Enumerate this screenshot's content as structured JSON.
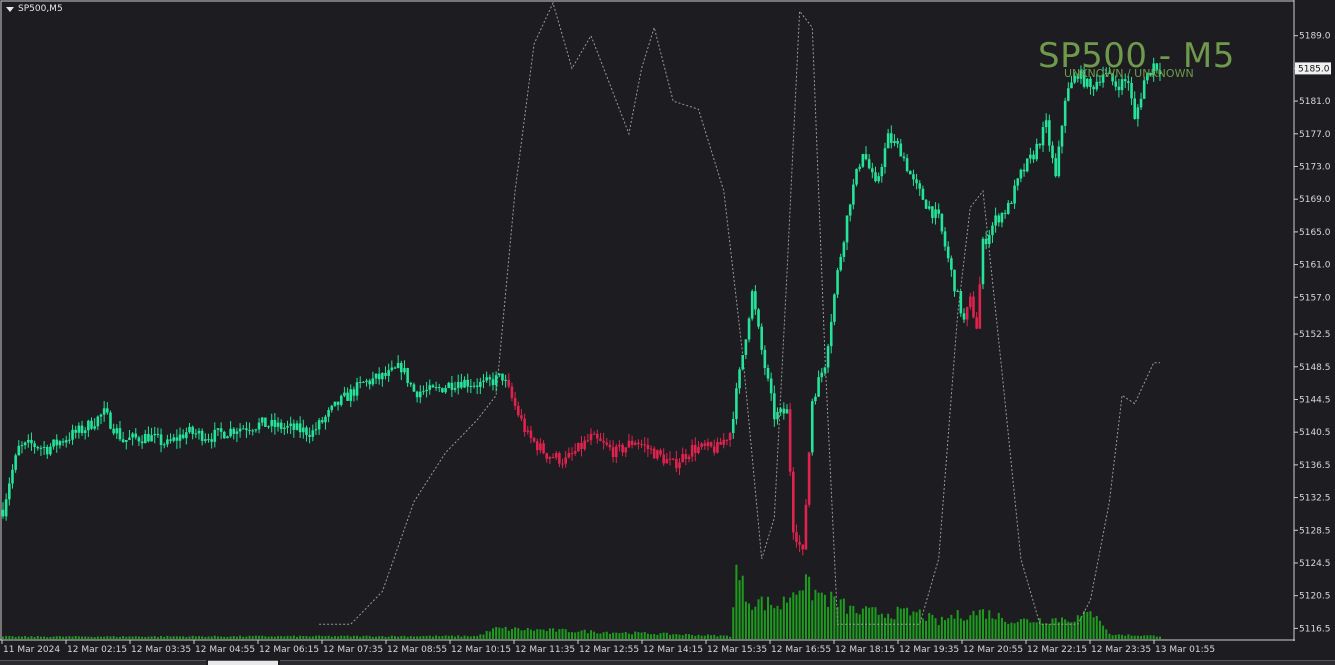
{
  "symbol_label": "SP500,M5",
  "watermark": {
    "title": "SP500 - M5",
    "subtitle": "UNKNOWN / UNKNOWN"
  },
  "colors": {
    "background": "#1c1c21",
    "bull": "#26e39a",
    "bear": "#e0234e",
    "volume": "#1e9c1e",
    "grid_text": "#d8d8d8",
    "indicator": "#9a9a9a",
    "current_price_bg": "#f0f0f0"
  },
  "current_price_label": "5185.0",
  "chart_data": {
    "type": "candlestick",
    "title": "",
    "xlabel": "",
    "ylabel": "",
    "ylim": [
      5115.2,
      5193.0
    ],
    "grid": false,
    "y_ticks": [
      "5189.0",
      "5185.0",
      "5181.0",
      "5177.0",
      "5173.0",
      "5169.0",
      "5165.0",
      "5161.0",
      "5157.0",
      "5152.5",
      "5148.5",
      "5144.5",
      "5140.5",
      "5136.5",
      "5132.5",
      "5128.5",
      "5124.5",
      "5120.5",
      "5116.5"
    ],
    "x_ticks": [
      "11 Mar 2024",
      "12 Mar 02:15",
      "12 Mar 03:35",
      "12 Mar 04:55",
      "12 Mar 06:15",
      "12 Mar 07:35",
      "12 Mar 08:55",
      "12 Mar 10:15",
      "12 Mar 11:35",
      "12 Mar 12:55",
      "12 Mar 14:15",
      "12 Mar 15:35",
      "12 Mar 16:55",
      "12 Mar 18:15",
      "12 Mar 19:35",
      "12 Mar 20:55",
      "12 Mar 22:15",
      "12 Mar 23:35",
      "13 Mar 01:55"
    ],
    "price_path": [
      {
        "bar": 0,
        "price": 5131.0
      },
      {
        "bar": 2,
        "price": 5134.5
      },
      {
        "bar": 5,
        "price": 5138.5
      },
      {
        "bar": 9,
        "price": 5139.0
      },
      {
        "bar": 14,
        "price": 5138.5
      },
      {
        "bar": 20,
        "price": 5139.8
      },
      {
        "bar": 26,
        "price": 5141.0
      },
      {
        "bar": 32,
        "price": 5142.8
      },
      {
        "bar": 38,
        "price": 5139.5
      },
      {
        "bar": 46,
        "price": 5140.0
      },
      {
        "bar": 52,
        "price": 5139.0
      },
      {
        "bar": 58,
        "price": 5140.5
      },
      {
        "bar": 66,
        "price": 5140.0
      },
      {
        "bar": 74,
        "price": 5141.0
      },
      {
        "bar": 82,
        "price": 5141.5
      },
      {
        "bar": 90,
        "price": 5141.0
      },
      {
        "bar": 98,
        "price": 5140.5
      },
      {
        "bar": 106,
        "price": 5144.0
      },
      {
        "bar": 114,
        "price": 5146.5
      },
      {
        "bar": 122,
        "price": 5147.5
      },
      {
        "bar": 126,
        "price": 5148.5
      },
      {
        "bar": 130,
        "price": 5145.5
      },
      {
        "bar": 136,
        "price": 5145.5
      },
      {
        "bar": 144,
        "price": 5146.8
      },
      {
        "bar": 152,
        "price": 5146.3
      },
      {
        "bar": 158,
        "price": 5147.3
      },
      {
        "bar": 160,
        "price": 5145.5
      },
      {
        "bar": 166,
        "price": 5140.0
      },
      {
        "bar": 172,
        "price": 5137.8
      },
      {
        "bar": 178,
        "price": 5137.0
      },
      {
        "bar": 186,
        "price": 5139.8
      },
      {
        "bar": 194,
        "price": 5138.0
      },
      {
        "bar": 200,
        "price": 5139.5
      },
      {
        "bar": 206,
        "price": 5138.0
      },
      {
        "bar": 212,
        "price": 5136.5
      },
      {
        "bar": 218,
        "price": 5138.5
      },
      {
        "bar": 226,
        "price": 5138.5
      },
      {
        "bar": 230,
        "price": 5140.5
      },
      {
        "bar": 234,
        "price": 5150.0
      },
      {
        "bar": 237,
        "price": 5157.5
      },
      {
        "bar": 240,
        "price": 5150.5
      },
      {
        "bar": 244,
        "price": 5142.5
      },
      {
        "bar": 248,
        "price": 5143.0
      },
      {
        "bar": 250,
        "price": 5129.0
      },
      {
        "bar": 253,
        "price": 5125.5
      },
      {
        "bar": 256,
        "price": 5144.5
      },
      {
        "bar": 260,
        "price": 5149.0
      },
      {
        "bar": 264,
        "price": 5160.0
      },
      {
        "bar": 268,
        "price": 5169.0
      },
      {
        "bar": 272,
        "price": 5175.0
      },
      {
        "bar": 276,
        "price": 5170.5
      },
      {
        "bar": 280,
        "price": 5176.5
      },
      {
        "bar": 284,
        "price": 5175.0
      },
      {
        "bar": 288,
        "price": 5171.0
      },
      {
        "bar": 292,
        "price": 5168.5
      },
      {
        "bar": 296,
        "price": 5166.5
      },
      {
        "bar": 300,
        "price": 5160.0
      },
      {
        "bar": 304,
        "price": 5154.0
      },
      {
        "bar": 306,
        "price": 5156.5
      },
      {
        "bar": 308,
        "price": 5153.5
      },
      {
        "bar": 310,
        "price": 5163.5
      },
      {
        "bar": 314,
        "price": 5166.5
      },
      {
        "bar": 318,
        "price": 5168.0
      },
      {
        "bar": 322,
        "price": 5172.0
      },
      {
        "bar": 326,
        "price": 5174.5
      },
      {
        "bar": 330,
        "price": 5178.0
      },
      {
        "bar": 333,
        "price": 5171.5
      },
      {
        "bar": 336,
        "price": 5181.5
      },
      {
        "bar": 340,
        "price": 5184.5
      },
      {
        "bar": 344,
        "price": 5182.5
      },
      {
        "bar": 348,
        "price": 5184.5
      },
      {
        "bar": 352,
        "price": 5183.0
      },
      {
        "bar": 356,
        "price": 5183.5
      },
      {
        "bar": 358,
        "price": 5178.5
      },
      {
        "bar": 361,
        "price": 5183.5
      },
      {
        "bar": 364,
        "price": 5185.5
      },
      {
        "bar": 366,
        "price": 5185.0
      }
    ],
    "volume_path": [
      {
        "bar": 0,
        "v": 0.08
      },
      {
        "bar": 150,
        "v": 0.1
      },
      {
        "bar": 156,
        "v": 0.35
      },
      {
        "bar": 230,
        "v": 0.1
      },
      {
        "bar": 232,
        "v": 2.2
      },
      {
        "bar": 236,
        "v": 1.3
      },
      {
        "bar": 246,
        "v": 1.1
      },
      {
        "bar": 252,
        "v": 1.9
      },
      {
        "bar": 256,
        "v": 1.6
      },
      {
        "bar": 270,
        "v": 0.9
      },
      {
        "bar": 290,
        "v": 0.85
      },
      {
        "bar": 296,
        "v": 0.55
      },
      {
        "bar": 300,
        "v": 0.75
      },
      {
        "bar": 310,
        "v": 0.9
      },
      {
        "bar": 320,
        "v": 0.6
      },
      {
        "bar": 340,
        "v": 0.7
      },
      {
        "bar": 346,
        "v": 0.9
      },
      {
        "bar": 350,
        "v": 0.15
      },
      {
        "bar": 366,
        "v": 0.1
      }
    ],
    "indicator_path": [
      {
        "bar": 100,
        "price": 5117.0
      },
      {
        "bar": 110,
        "price": 5117.0
      },
      {
        "bar": 120,
        "price": 5121.0
      },
      {
        "bar": 130,
        "price": 5132.0
      },
      {
        "bar": 140,
        "price": 5138.0
      },
      {
        "bar": 150,
        "price": 5142.0
      },
      {
        "bar": 156,
        "price": 5145.0
      },
      {
        "bar": 162,
        "price": 5170.0
      },
      {
        "bar": 168,
        "price": 5188.0
      },
      {
        "bar": 174,
        "price": 5193.0
      },
      {
        "bar": 180,
        "price": 5185.0
      },
      {
        "bar": 186,
        "price": 5189.0
      },
      {
        "bar": 192,
        "price": 5183.0
      },
      {
        "bar": 198,
        "price": 5177.0
      },
      {
        "bar": 202,
        "price": 5185.0
      },
      {
        "bar": 206,
        "price": 5190.0
      },
      {
        "bar": 212,
        "price": 5181.0
      },
      {
        "bar": 220,
        "price": 5180.0
      },
      {
        "bar": 228,
        "price": 5170.0
      },
      {
        "bar": 234,
        "price": 5150.0
      },
      {
        "bar": 240,
        "price": 5125.0
      },
      {
        "bar": 244,
        "price": 5130.0
      },
      {
        "bar": 248,
        "price": 5160.0
      },
      {
        "bar": 252,
        "price": 5192.0
      },
      {
        "bar": 256,
        "price": 5190.0
      },
      {
        "bar": 260,
        "price": 5150.0
      },
      {
        "bar": 264,
        "price": 5117.0
      },
      {
        "bar": 290,
        "price": 5117.0
      },
      {
        "bar": 296,
        "price": 5125.0
      },
      {
        "bar": 302,
        "price": 5155.0
      },
      {
        "bar": 306,
        "price": 5168.0
      },
      {
        "bar": 310,
        "price": 5170.0
      },
      {
        "bar": 316,
        "price": 5148.0
      },
      {
        "bar": 322,
        "price": 5125.0
      },
      {
        "bar": 328,
        "price": 5117.0
      },
      {
        "bar": 340,
        "price": 5117.0
      },
      {
        "bar": 344,
        "price": 5120.0
      },
      {
        "bar": 350,
        "price": 5132.0
      },
      {
        "bar": 354,
        "price": 5145.0
      },
      {
        "bar": 358,
        "price": 5144.0
      },
      {
        "bar": 364,
        "price": 5149.0
      },
      {
        "bar": 366,
        "price": 5149.0
      }
    ]
  }
}
